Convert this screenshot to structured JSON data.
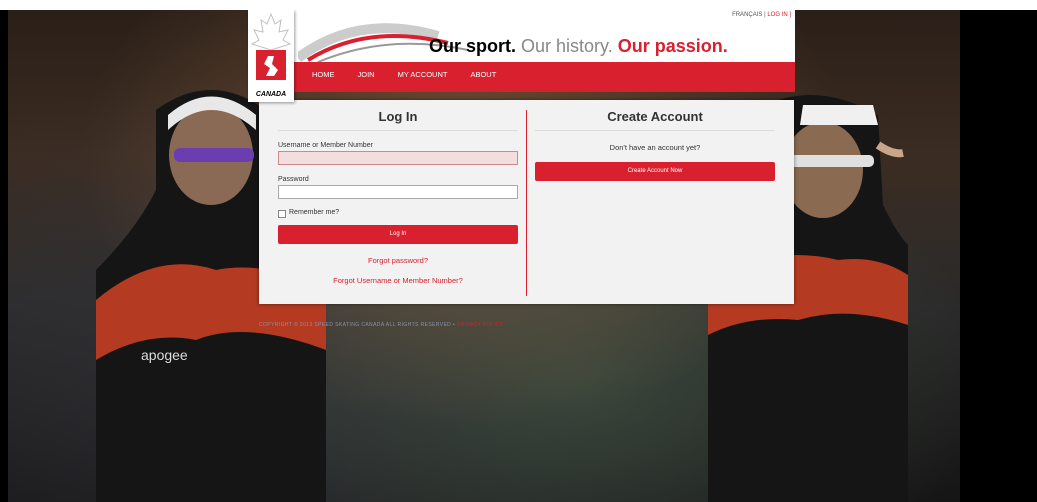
{
  "header": {
    "lang_link": "FRANÇAIS",
    "login_link": "LOG IN",
    "tagline_part1": "Our sport.",
    "tagline_part2": "Our history.",
    "tagline_part3": "Our passion.",
    "logo_text": "CANADA"
  },
  "nav": {
    "items": [
      "HOME",
      "JOIN",
      "MY ACCOUNT",
      "ABOUT"
    ]
  },
  "login": {
    "title": "Log In",
    "username_label": "Username or Member Number",
    "username_value": "",
    "password_label": "Password",
    "password_value": "",
    "remember_label": "Remember me?",
    "submit_label": "Log In",
    "forgot_password": "Forgot password?",
    "forgot_username": "Forgot Username or Member Number?"
  },
  "create": {
    "title": "Create Account",
    "prompt": "Don't have an account yet?",
    "button_label": "Create Account Now"
  },
  "footer": {
    "copyright": "COPYRIGHT © 2013 SPEED SKATING CANADA ALL RIGHTS RESERVED",
    "separator": "•",
    "privacy": "PRIVACY POLICY"
  },
  "colors": {
    "brand_red": "#d8202f",
    "error_field": "#f2dede"
  }
}
